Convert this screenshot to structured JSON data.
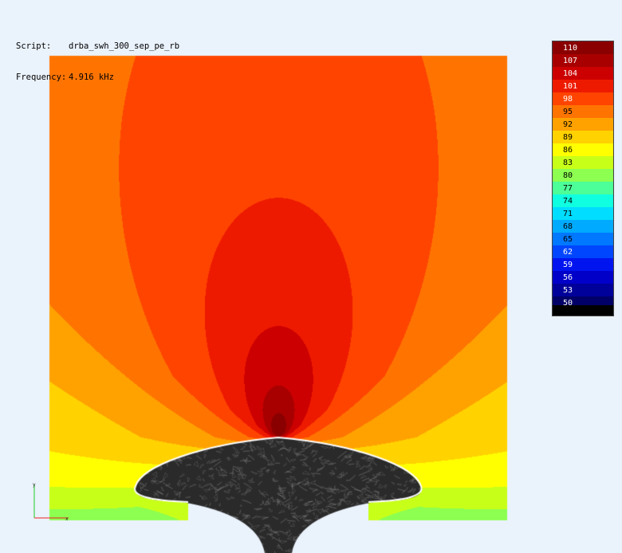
{
  "info": {
    "script_label": "Script:",
    "script_value": "drba_swh_300_sep_pe_rb",
    "frequency_label": "Frequency:",
    "frequency_value": "4.916 kHz"
  },
  "legend": {
    "levels": [
      {
        "value": "110",
        "color": "#8a0000",
        "text_color": "#ffffff"
      },
      {
        "value": "107",
        "color": "#a80000",
        "text_color": "#ffffff"
      },
      {
        "value": "104",
        "color": "#cc0000",
        "text_color": "#ffffff"
      },
      {
        "value": "101",
        "color": "#ee1a00",
        "text_color": "#ffffff"
      },
      {
        "value": "98",
        "color": "#ff4400",
        "text_color": "#ffffff"
      },
      {
        "value": "95",
        "color": "#ff7400",
        "text_color": "#000000"
      },
      {
        "value": "92",
        "color": "#ffa200",
        "text_color": "#000000"
      },
      {
        "value": "89",
        "color": "#ffd200",
        "text_color": "#000000"
      },
      {
        "value": "86",
        "color": "#ffff00",
        "text_color": "#000000"
      },
      {
        "value": "83",
        "color": "#c8ff18",
        "text_color": "#000000"
      },
      {
        "value": "80",
        "color": "#8cff50",
        "text_color": "#000000"
      },
      {
        "value": "77",
        "color": "#4cff98",
        "text_color": "#000000"
      },
      {
        "value": "74",
        "color": "#10ffe0",
        "text_color": "#000000"
      },
      {
        "value": "71",
        "color": "#00ddff",
        "text_color": "#000000"
      },
      {
        "value": "68",
        "color": "#00aaff",
        "text_color": "#000000"
      },
      {
        "value": "65",
        "color": "#0078ff",
        "text_color": "#000000"
      },
      {
        "value": "62",
        "color": "#0046ff",
        "text_color": "#ffffff"
      },
      {
        "value": "59",
        "color": "#0014f0",
        "text_color": "#ffffff"
      },
      {
        "value": "56",
        "color": "#0000c8",
        "text_color": "#ffffff"
      },
      {
        "value": "53",
        "color": "#00009a",
        "text_color": "#ffffff"
      },
      {
        "value": "50",
        "color": "#000068",
        "text_color": "#ffffff"
      }
    ]
  },
  "axes_triad": {
    "x_label": "x",
    "y_label": "y"
  }
}
